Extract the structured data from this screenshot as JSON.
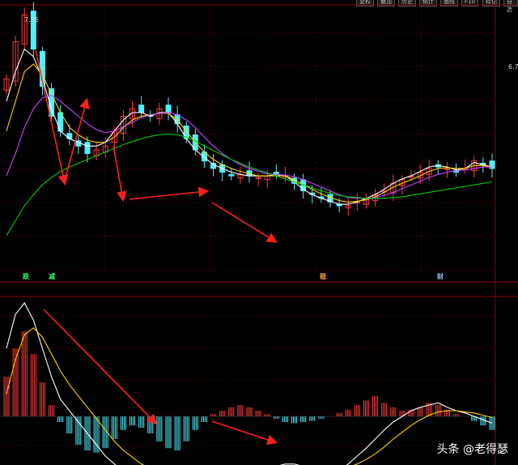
{
  "topbar": {
    "buttons": [
      "复权",
      "叠加",
      "历史",
      "统计",
      "画线",
      "F10",
      "标记",
      "自选"
    ]
  },
  "price_panel": {
    "high_label": "7.76",
    "right_label": "6.7",
    "tags": [
      {
        "text": "跌",
        "color": "#33ff66"
      },
      {
        "text": "减",
        "color": "#33ff66"
      },
      {
        "text": "稳",
        "color": "#ff9933"
      },
      {
        "text": "财",
        "color": "#9ab8ff"
      }
    ]
  },
  "watermark": "头条 @老得瑟",
  "colors": {
    "up": "#ff3b3b",
    "down": "#4ff0ff",
    "ma_short": "#ffffff",
    "ma_mid": "#ffd400",
    "ma_long": "#cc44ff",
    "ma_xlong": "#00cc00",
    "arrow": "#ff2020",
    "grid": "#8b0000",
    "macd_dif": "#ffffff",
    "macd_dea": "#ffd400"
  },
  "chart_data": [
    {
      "type": "candlestick",
      "title": "",
      "xlabel": "",
      "ylabel": "",
      "grid": true,
      "series": [
        {
          "kind": "close",
          "values": [
            6.9,
            7.4,
            7.76,
            7.3,
            6.8,
            6.4,
            6.2,
            6.1,
            6.0,
            5.9,
            5.95,
            6.0,
            6.2,
            6.4,
            6.5,
            6.45,
            6.4,
            6.5,
            6.45,
            6.3,
            6.1,
            5.95,
            5.8,
            5.7,
            5.65,
            5.6,
            5.62,
            5.6,
            5.58,
            5.6,
            5.62,
            5.6,
            5.5,
            5.4,
            5.35,
            5.3,
            5.25,
            5.2,
            5.2,
            5.25,
            5.3,
            5.35,
            5.4,
            5.5,
            5.55,
            5.6,
            5.65,
            5.7,
            5.72,
            5.7,
            5.65,
            5.7,
            5.8,
            5.75,
            5.7
          ]
        },
        {
          "kind": "ma_short",
          "values": [
            6.6,
            7.0,
            7.3,
            7.2,
            6.9,
            6.5,
            6.2,
            6.1,
            6.05,
            6.0,
            6.0,
            6.05,
            6.2,
            6.35,
            6.45,
            6.45,
            6.4,
            6.45,
            6.45,
            6.3,
            6.1,
            5.95,
            5.85,
            5.75,
            5.7,
            5.65,
            5.62,
            5.6,
            5.6,
            5.6,
            5.62,
            5.6,
            5.52,
            5.42,
            5.35,
            5.3,
            5.26,
            5.22,
            5.22,
            5.25,
            5.3,
            5.35,
            5.42,
            5.5,
            5.56,
            5.6,
            5.66,
            5.72,
            5.74,
            5.72,
            5.68,
            5.7,
            5.78,
            5.75,
            5.72
          ]
        },
        {
          "kind": "ma_mid",
          "values": [
            6.2,
            6.6,
            7.0,
            7.1,
            6.95,
            6.7,
            6.45,
            6.25,
            6.15,
            6.08,
            6.05,
            6.05,
            6.12,
            6.25,
            6.35,
            6.4,
            6.42,
            6.44,
            6.44,
            6.35,
            6.2,
            6.05,
            5.92,
            5.82,
            5.75,
            5.7,
            5.66,
            5.63,
            5.6,
            5.6,
            5.6,
            5.6,
            5.55,
            5.48,
            5.42,
            5.36,
            5.31,
            5.27,
            5.25,
            5.26,
            5.28,
            5.32,
            5.38,
            5.45,
            5.5,
            5.55,
            5.6,
            5.66,
            5.7,
            5.71,
            5.7,
            5.7,
            5.74,
            5.74,
            5.72
          ]
        },
        {
          "kind": "ma_long",
          "values": [
            5.6,
            5.9,
            6.25,
            6.5,
            6.65,
            6.68,
            6.6,
            6.5,
            6.4,
            6.3,
            6.22,
            6.18,
            6.2,
            6.26,
            6.32,
            6.38,
            6.42,
            6.44,
            6.45,
            6.42,
            6.35,
            6.25,
            6.12,
            6.0,
            5.9,
            5.82,
            5.75,
            5.7,
            5.66,
            5.63,
            5.62,
            5.61,
            5.59,
            5.55,
            5.5,
            5.45,
            5.4,
            5.35,
            5.31,
            5.3,
            5.3,
            5.31,
            5.34,
            5.38,
            5.43,
            5.48,
            5.53,
            5.58,
            5.62,
            5.65,
            5.67,
            5.68,
            5.7,
            5.72,
            5.72
          ]
        },
        {
          "kind": "ma_xlong",
          "values": [
            4.8,
            5.0,
            5.2,
            5.35,
            5.48,
            5.58,
            5.66,
            5.72,
            5.77,
            5.82,
            5.87,
            5.92,
            5.97,
            6.02,
            6.06,
            6.1,
            6.13,
            6.15,
            6.16,
            6.15,
            6.12,
            6.07,
            6.0,
            5.94,
            5.88,
            5.82,
            5.77,
            5.72,
            5.68,
            5.64,
            5.6,
            5.56,
            5.52,
            5.48,
            5.44,
            5.4,
            5.37,
            5.34,
            5.32,
            5.31,
            5.3,
            5.3,
            5.3,
            5.31,
            5.32,
            5.34,
            5.36,
            5.38,
            5.4,
            5.42,
            5.44,
            5.46,
            5.48,
            5.5,
            5.52
          ]
        }
      ]
    },
    {
      "type": "bar",
      "title": "",
      "xlabel": "",
      "ylabel": "",
      "series": [
        {
          "kind": "macd_hist",
          "values": [
            0.35,
            0.6,
            0.75,
            0.55,
            0.3,
            0.1,
            -0.05,
            -0.15,
            -0.25,
            -0.3,
            -0.32,
            -0.28,
            -0.2,
            -0.12,
            -0.08,
            -0.1,
            -0.15,
            -0.22,
            -0.28,
            -0.3,
            -0.22,
            -0.12,
            -0.05,
            0.02,
            0.05,
            0.08,
            0.1,
            0.08,
            0.05,
            0.02,
            -0.02,
            -0.05,
            -0.06,
            -0.05,
            -0.04,
            -0.02,
            0.0,
            0.03,
            0.06,
            0.1,
            0.14,
            0.18,
            0.12,
            0.08,
            0.05,
            0.06,
            0.08,
            0.12,
            0.1,
            0.06,
            0.02,
            0.0,
            -0.04,
            -0.08,
            -0.12
          ]
        },
        {
          "kind": "dif",
          "values": [
            0.6,
            0.9,
            1.0,
            0.85,
            0.6,
            0.35,
            0.15,
            0.05,
            -0.05,
            -0.15,
            -0.25,
            -0.35,
            -0.42,
            -0.48,
            -0.5,
            -0.52,
            -0.52,
            -0.5,
            -0.48,
            -0.46,
            -0.45,
            -0.46,
            -0.48,
            -0.5,
            -0.52,
            -0.53,
            -0.52,
            -0.5,
            -0.48,
            -0.46,
            -0.44,
            -0.42,
            -0.42,
            -0.44,
            -0.46,
            -0.48,
            -0.5,
            -0.48,
            -0.42,
            -0.35,
            -0.28,
            -0.2,
            -0.12,
            -0.05,
            0.0,
            0.05,
            0.08,
            0.1,
            0.12,
            0.08,
            0.05,
            0.03,
            0.0,
            -0.03,
            -0.06
          ]
        },
        {
          "kind": "dea",
          "values": [
            0.2,
            0.5,
            0.72,
            0.78,
            0.7,
            0.55,
            0.4,
            0.28,
            0.18,
            0.08,
            -0.02,
            -0.12,
            -0.22,
            -0.3,
            -0.36,
            -0.42,
            -0.46,
            -0.48,
            -0.49,
            -0.49,
            -0.48,
            -0.47,
            -0.47,
            -0.48,
            -0.49,
            -0.5,
            -0.5,
            -0.5,
            -0.49,
            -0.48,
            -0.47,
            -0.46,
            -0.45,
            -0.45,
            -0.45,
            -0.46,
            -0.47,
            -0.47,
            -0.45,
            -0.42,
            -0.38,
            -0.33,
            -0.27,
            -0.2,
            -0.14,
            -0.08,
            -0.03,
            0.01,
            0.04,
            0.05,
            0.05,
            0.04,
            0.03,
            0.01,
            -0.01
          ]
        }
      ]
    }
  ]
}
